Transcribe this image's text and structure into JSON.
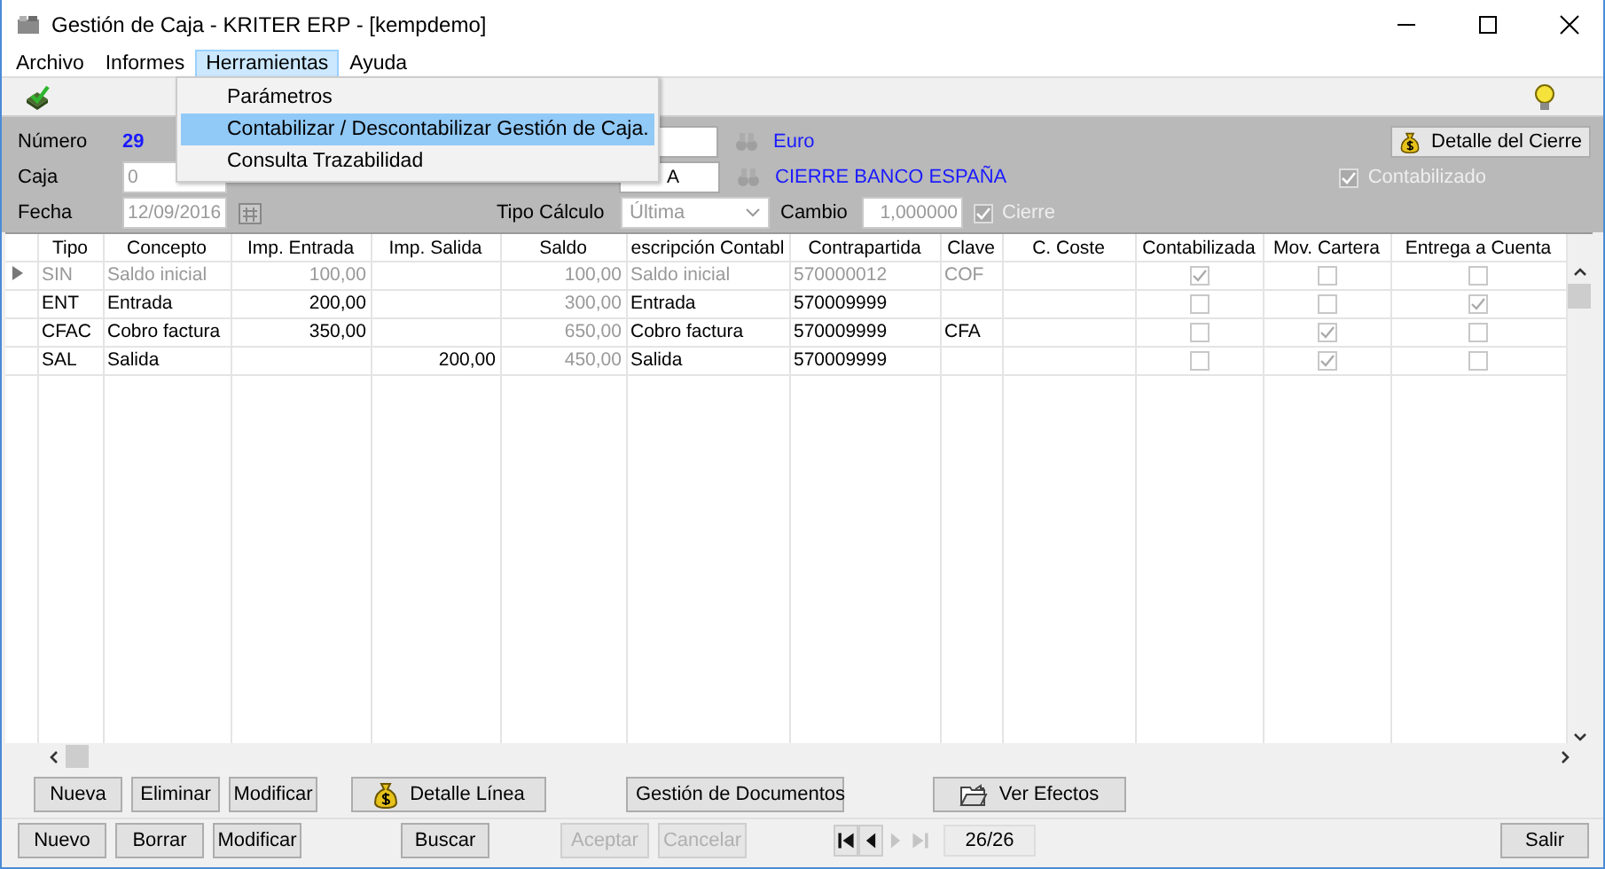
{
  "window": {
    "title": "Gestión de Caja - KRITER ERP - [kempdemo]"
  },
  "menu": [
    {
      "label": "Archivo",
      "selected": false
    },
    {
      "label": "Informes",
      "selected": false
    },
    {
      "label": "Herramientas",
      "selected": true
    },
    {
      "label": "Ayuda",
      "selected": false
    }
  ],
  "dropdown": [
    {
      "label": "Parámetros",
      "selected": false
    },
    {
      "label": "Contabilizar / Descontabilizar Gestión de Caja.",
      "selected": true
    },
    {
      "label": "Consulta Trazabilidad",
      "selected": false
    }
  ],
  "form": {
    "numero": {
      "label": "Número",
      "value": "29"
    },
    "caja": {
      "label": "Caja",
      "value": "0",
      "disabled": true
    },
    "fecha": {
      "label": "Fecha",
      "value": "12/09/2016",
      "disabled": true
    },
    "tipo_calculo": {
      "label": "Tipo Cálculo",
      "value": "Última",
      "disabled": true
    },
    "moneda": {
      "name": "Euro"
    },
    "banco": {
      "value": "A",
      "name": "CIERRE BANCO ESPAÑA"
    },
    "cambio": {
      "label": "Cambio",
      "value": "1,000000",
      "disabled": true
    },
    "cierre": {
      "label": "Cierre",
      "checked": true,
      "disabled": true
    },
    "detalle_cierre": {
      "label": "Detalle del Cierre"
    },
    "contabilizado": {
      "label": "Contabilizado",
      "checked": true,
      "disabled": true
    }
  },
  "table": {
    "columns": [
      {
        "label": "Tipo",
        "kind": "text"
      },
      {
        "label": "Concepto",
        "kind": "text"
      },
      {
        "label": "Imp. Entrada",
        "kind": "number"
      },
      {
        "label": "Imp. Salida",
        "kind": "number"
      },
      {
        "label": "Saldo",
        "kind": "number",
        "dimmed": true
      },
      {
        "label": "escripción Contabl",
        "kind": "text"
      },
      {
        "label": "Contrapartida",
        "kind": "text"
      },
      {
        "label": "Clave",
        "kind": "text"
      },
      {
        "label": "C. Coste",
        "kind": "text"
      },
      {
        "label": "Contabilizada",
        "kind": "check"
      },
      {
        "label": "Mov. Cartera",
        "kind": "check"
      },
      {
        "label": "Entrega a Cuenta",
        "kind": "check"
      }
    ],
    "rows": [
      {
        "current": true,
        "dimmed": true,
        "tipo": "SIN",
        "concepto": "Saldo inicial",
        "imp_entrada": "100,00",
        "saldo": "100,00",
        "descripcion": "Saldo inicial",
        "contrapartida": "570000012",
        "clave": "COF",
        "contabilizada": true,
        "mov_cartera": false,
        "entrega_cuenta": false
      },
      {
        "dimmed": false,
        "tipo": "ENT",
        "concepto": "Entrada",
        "imp_entrada": "200,00",
        "saldo": "300,00",
        "descripcion": "Entrada",
        "contrapartida": "570009999",
        "contabilizada": false,
        "mov_cartera": false,
        "entrega_cuenta": true
      },
      {
        "dimmed": false,
        "tipo": "CFAC",
        "concepto": "Cobro factura",
        "imp_entrada": "350,00",
        "saldo": "650,00",
        "descripcion": "Cobro factura",
        "contrapartida": "570009999",
        "clave": "CFA",
        "contabilizada": false,
        "mov_cartera": true,
        "entrega_cuenta": false
      },
      {
        "dimmed": false,
        "tipo": "SAL",
        "concepto": "Salida",
        "imp_salida": "200,00",
        "saldo": "450,00",
        "descripcion": "Salida",
        "contrapartida": "570009999",
        "contabilizada": false,
        "mov_cartera": true,
        "entrega_cuenta": false
      }
    ]
  },
  "line_buttons": [
    {
      "label": "Nueva"
    },
    {
      "label": "Eliminar"
    },
    {
      "label": "Modificar"
    },
    {
      "label": "Detalle Línea"
    },
    {
      "label": "Gestión de Documentos"
    },
    {
      "label": "Ver Efectos"
    }
  ],
  "bottom_buttons": [
    {
      "label": "Nuevo",
      "disabled": false
    },
    {
      "label": "Borrar",
      "disabled": false
    },
    {
      "label": "Modificar",
      "disabled": false
    },
    {
      "label": "Buscar",
      "disabled": false
    },
    {
      "label": "Aceptar",
      "disabled": true
    },
    {
      "label": "Cancelar",
      "disabled": true
    }
  ],
  "navigator": {
    "buttons": [
      {
        "kind": "first",
        "disabled": false
      },
      {
        "kind": "prev",
        "disabled": false
      },
      {
        "kind": "next",
        "disabled": true
      },
      {
        "kind": "last",
        "disabled": true
      }
    ],
    "position": "26/26"
  },
  "exit_button": {
    "label": "Salir"
  }
}
